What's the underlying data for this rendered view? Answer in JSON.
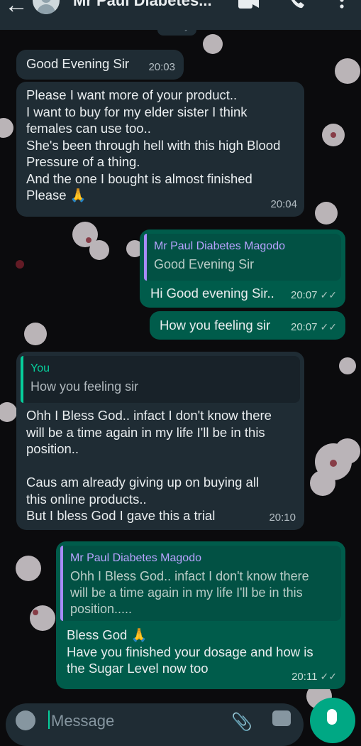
{
  "header": {
    "contact_name": "Mr Paul Diabetes...",
    "back_icon": "arrow-left-icon",
    "video_icon": "video-call-icon",
    "call_icon": "phone-call-icon",
    "menu_icon": "more-vert-icon"
  },
  "date_chip": "Today",
  "messages": [
    {
      "direction": "in",
      "text": "Good Evening Sir",
      "time": "20:03"
    },
    {
      "direction": "in",
      "text": "Please I want more of your product..\nI want to buy for my elder sister I think\nfemales can use too..\nShe's been through hell with this high Blood\nPressure of a thing.\nAnd the one I bought is almost finished\nPlease 🙏",
      "time": "20:04"
    },
    {
      "direction": "out",
      "quote_author": "Mr Paul Diabetes Magodo",
      "quote_text": "Good Evening Sir",
      "text": "Hi Good evening Sir..",
      "time": "20:07",
      "ticks": "✓✓"
    },
    {
      "direction": "out",
      "text": "How you feeling sir",
      "time": "20:07",
      "ticks": "✓✓"
    },
    {
      "direction": "in",
      "quote_author": "You",
      "quote_text": "How you feeling sir",
      "text": "Ohh I Bless God.. infact I don't know there\nwill be a time again in my life I'll be in this\nposition..\n\nCaus am already giving up on buying all\nthis online products..\nBut I bless God I gave this a trial",
      "time": "20:10"
    },
    {
      "direction": "out",
      "quote_author": "Mr Paul Diabetes Magodo",
      "quote_text": "Ohh I Bless God.. infact I don't know there\nwill be a time again in my life I'll be in this\nposition.....",
      "text": "Bless God 🙏\nHave you finished your dosage and how is\nthe Sugar Level now too",
      "time": "20:11",
      "ticks": "✓✓"
    }
  ],
  "composer": {
    "placeholder": "Message",
    "emoji_icon": "emoji-icon",
    "attach_icon": "paperclip-icon",
    "camera_icon": "camera-icon",
    "mic_icon": "microphone-icon"
  },
  "colors": {
    "incoming_bubble": "#1f2c34",
    "outgoing_bubble": "#005c4b",
    "accent": "#00a884"
  }
}
